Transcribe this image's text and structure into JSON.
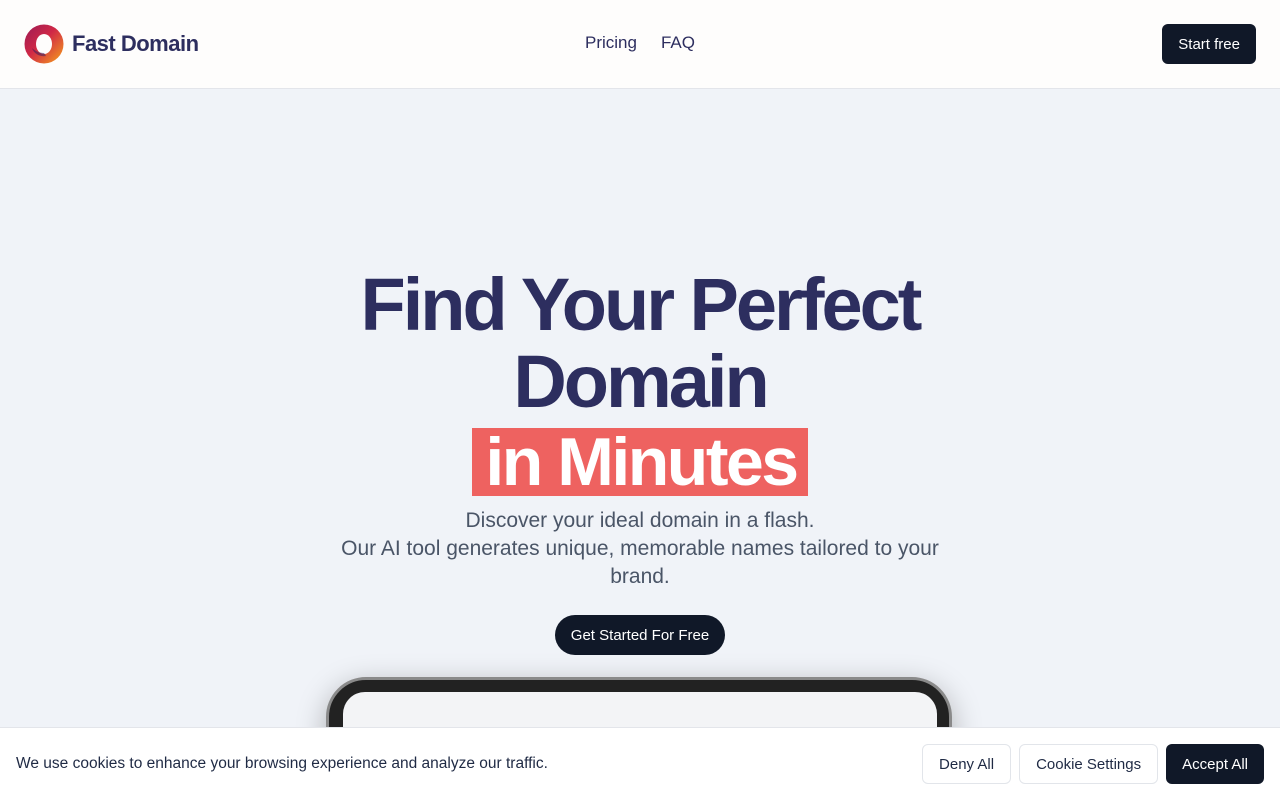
{
  "colors": {
    "headline": "#2d2e5f",
    "highlight": "#ee6260",
    "dark_button": "#101828",
    "background": "#f0f3f8"
  },
  "header": {
    "logo_icon": "ring-logo-icon",
    "brand_name": "Fast Domain",
    "nav": [
      {
        "label": "Pricing"
      },
      {
        "label": "FAQ"
      }
    ],
    "cta_label": "Start free"
  },
  "hero": {
    "headline_line1": "Find Your Perfect",
    "headline_line2": "Domain",
    "headline_highlight": "in Minutes",
    "subtitle_line1": "Discover your ideal domain in a flash.",
    "subtitle_line2": "Our AI tool generates unique, memorable names tailored to your brand.",
    "cta_label": "Get Started For Free"
  },
  "cookie_banner": {
    "message": "We use cookies to enhance your browsing experience and analyze our traffic.",
    "deny_label": "Deny All",
    "settings_label": "Cookie Settings",
    "accept_label": "Accept All"
  }
}
